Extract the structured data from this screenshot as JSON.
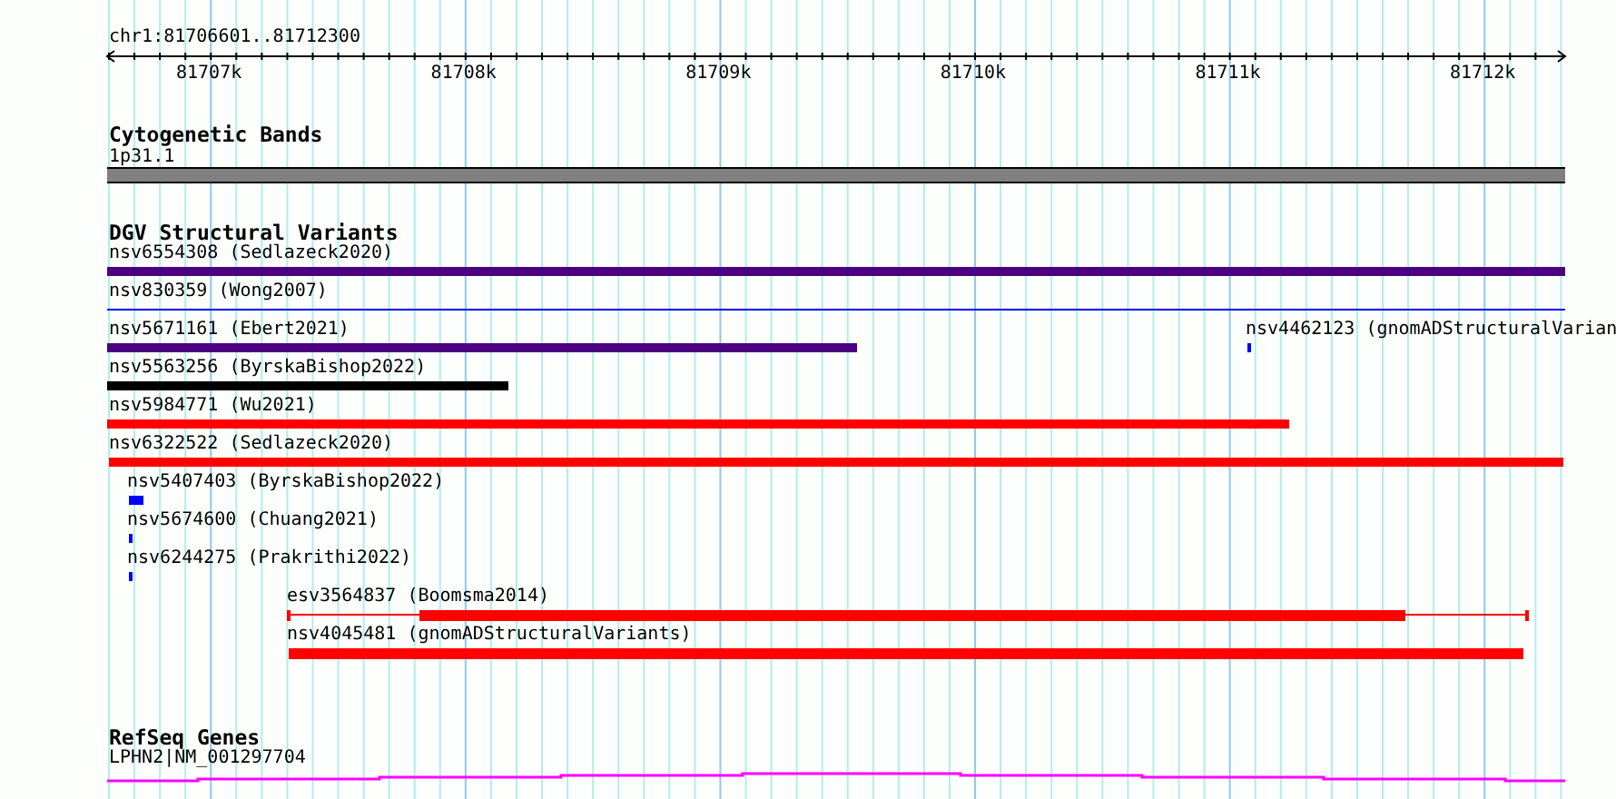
{
  "ruler": {
    "location": "chr1:81706601..81712300",
    "ticks": [
      "81707k",
      "81708k",
      "81709k",
      "81710k",
      "81711k",
      "81712k"
    ]
  },
  "tracks": [
    {
      "title": "Cytogenetic Bands",
      "features": [
        {
          "label": "1p31.1",
          "kind": "band",
          "color": "#808080"
        }
      ]
    },
    {
      "title": "DGV Structural Variants",
      "features": [
        {
          "label": "nsv6554308 (Sedlazeck2020)",
          "kind": "bar",
          "color": "#4b0082"
        },
        {
          "label": "nsv830359 (Wong2007)",
          "kind": "line",
          "color": "#0000ff"
        },
        {
          "label": "nsv5671161 (Ebert2021)",
          "kind": "bar",
          "color": "#4b0082"
        },
        {
          "label": "nsv4462123 (gnomADStructuralVarian",
          "kind": "bar",
          "color": "#0000ff"
        },
        {
          "label": "nsv5563256 (ByrskaBishop2022)",
          "kind": "bar",
          "color": "#000000"
        },
        {
          "label": "nsv5984771 (Wu2021)",
          "kind": "bar",
          "color": "#ff0000"
        },
        {
          "label": "nsv6322522 (Sedlazeck2020)",
          "kind": "bar",
          "color": "#ff0000"
        },
        {
          "label": "nsv5407403 (ByrskaBishop2022)",
          "kind": "bar",
          "color": "#0000ff"
        },
        {
          "label": "nsv5674600 (Chuang2021)",
          "kind": "bar",
          "color": "#0000ff"
        },
        {
          "label": "nsv6244275 (Prakrithi2022)",
          "kind": "bar",
          "color": "#0000ff"
        },
        {
          "label": "esv3564837 (Boomsma2014)",
          "kind": "gapped",
          "color": "#ff0000"
        },
        {
          "label": "nsv4045481 (gnomADStructuralVariants)",
          "kind": "bar",
          "color": "#ff0000"
        }
      ]
    },
    {
      "title": "RefSeq Genes",
      "features": [
        {
          "label": "LPHN2|NM_001297704",
          "kind": "gene",
          "color": "#ff00ff"
        }
      ]
    }
  ]
}
